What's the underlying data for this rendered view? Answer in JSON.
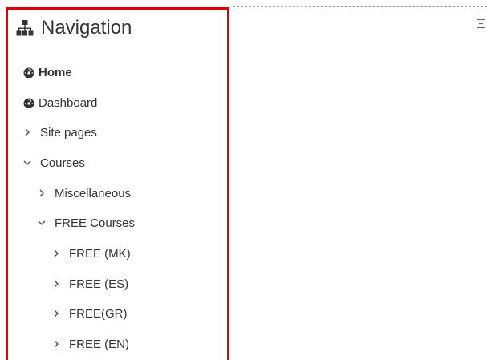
{
  "navigation": {
    "title": "Navigation",
    "title_icon": "sitemap-icon",
    "items": [
      {
        "label": "Home",
        "icon": "dashboard-gauge-icon",
        "bold": true
      },
      {
        "label": "Dashboard",
        "icon": "dashboard-gauge-icon",
        "bold": false
      },
      {
        "label": "Site pages",
        "icon": "chevron-right-icon",
        "expanded": false
      },
      {
        "label": "Courses",
        "icon": "chevron-down-icon",
        "expanded": true
      },
      {
        "label": "Miscellaneous",
        "icon": "chevron-right-icon",
        "expanded": false
      },
      {
        "label": "FREE Courses",
        "icon": "chevron-down-icon",
        "expanded": true
      },
      {
        "label": "FREE (MK)",
        "icon": "chevron-right-icon",
        "expanded": false
      },
      {
        "label": "FREE (ES)",
        "icon": "chevron-right-icon",
        "expanded": false
      },
      {
        "label": "FREE(GR)",
        "icon": "chevron-right-icon",
        "expanded": false
      },
      {
        "label": "FREE (EN)",
        "icon": "chevron-right-icon",
        "expanded": false
      }
    ]
  },
  "dock_icon": "dock-block-icon",
  "colors": {
    "highlight_border": "#e00000",
    "text": "#333333"
  }
}
